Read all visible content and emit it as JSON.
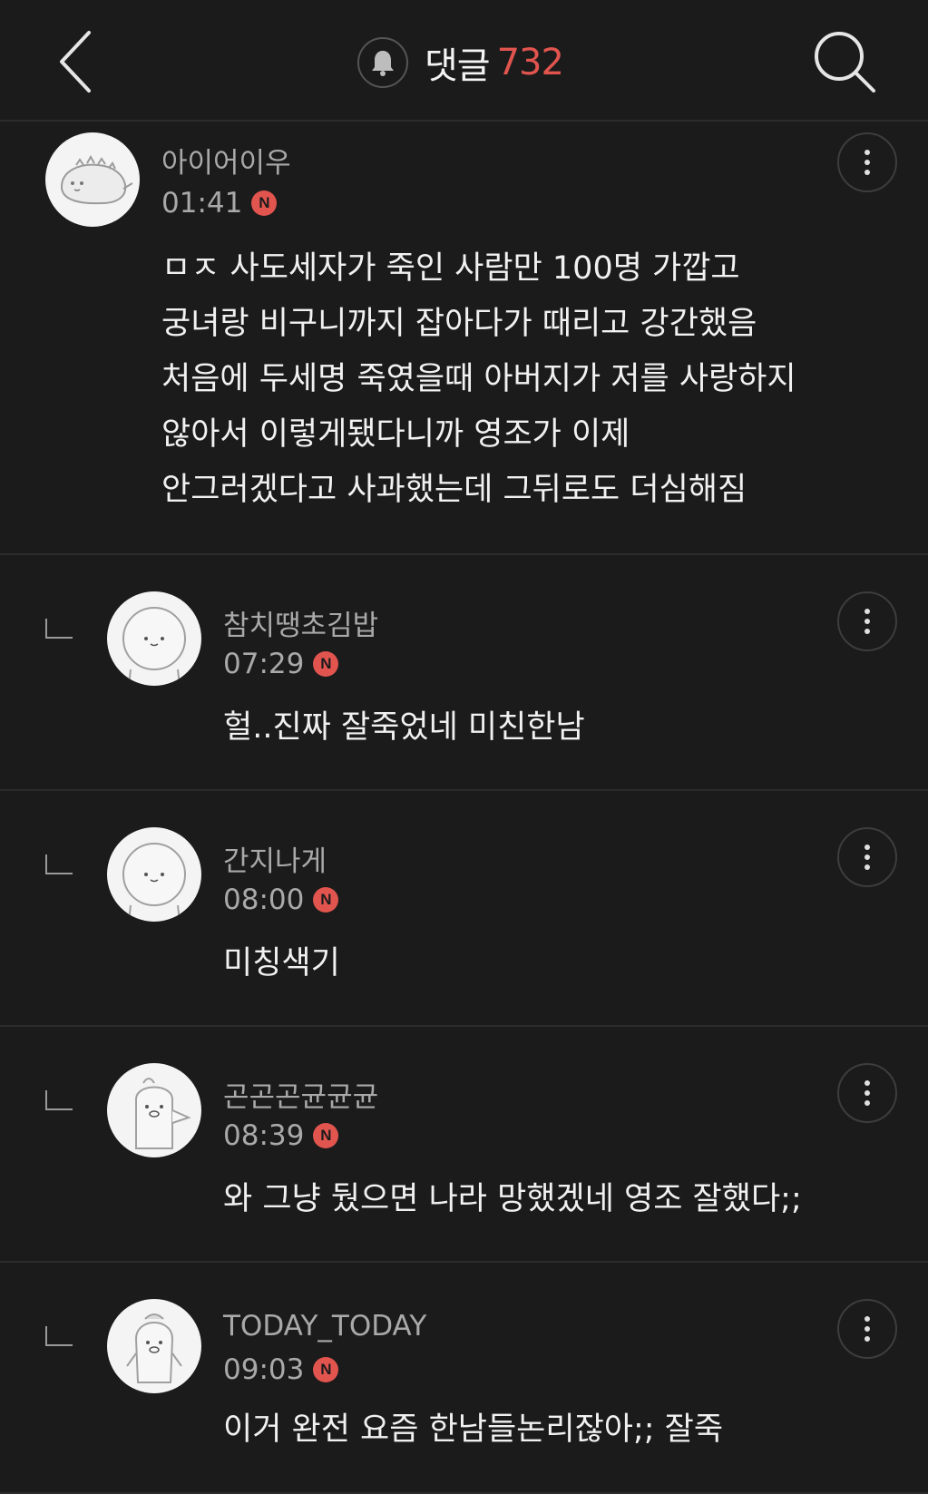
{
  "header": {
    "title": "댓글",
    "count": "732",
    "icons": {
      "back": "chevron-left-icon",
      "bell": "bell-icon",
      "search": "search-icon"
    }
  },
  "comments": [
    {
      "nickname": "아이어이우",
      "time": "01:41",
      "badge": "N",
      "lines": [
        "ㅁㅈ 사도세자가 죽인 사람만 100명 가깝고",
        "궁녀랑 비구니까지 잡아다가 때리고 강간했음",
        "처음에 두세명 죽였을때 아버지가 저를 사랑하지",
        "않아서 이렇게됐다니까 영조가 이제",
        "안그러겠다고 사과했는데 그뒤로도 더심해짐"
      ]
    },
    {
      "nickname": "참치땡초김밥",
      "time": "07:29",
      "badge": "N",
      "lines": [
        "헐..진짜 잘죽었네 미친한남"
      ]
    },
    {
      "nickname": "간지나게",
      "time": "08:00",
      "badge": "N",
      "lines": [
        "미칭색기"
      ]
    },
    {
      "nickname": "곤곤곤균균균",
      "time": "08:39",
      "badge": "N",
      "lines": [
        "와 그냥 뒀으면 나라 망했겠네 영조 잘했다;;"
      ]
    },
    {
      "nickname": "TODAY_TODAY",
      "time": "09:03",
      "badge": "N",
      "lines": [
        "이거 완전 요즘 한남들논리잖아;; 잘죽"
      ]
    }
  ],
  "colors": {
    "background": "#1b1b1b",
    "accent": "#e2554f",
    "text": "#f1f1f1",
    "muted": "#a9a9a9"
  }
}
